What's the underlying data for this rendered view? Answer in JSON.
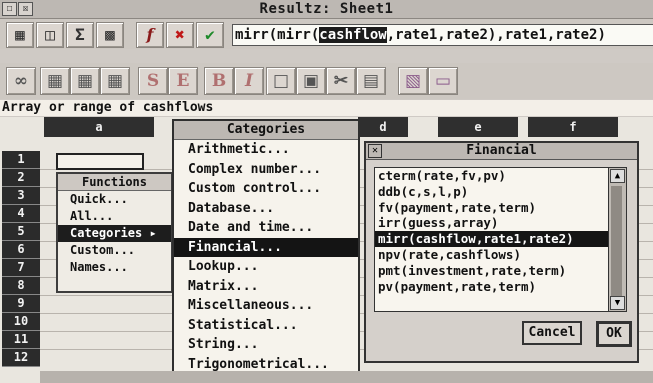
{
  "window": {
    "title": "Resultz: Sheet1",
    "close_glyph": "☒",
    "back_glyph": "☐"
  },
  "toolbar": {
    "sum_label": "Σ",
    "function_label": "f",
    "cancel_glyph": "✖",
    "accept_glyph": "✔",
    "formula_prefix": "mirr(mirr(",
    "formula_highlight": "cashflow",
    "formula_suffix": ",rate1,rate2),rate1,rate2)",
    "s_label": "S",
    "e_label": "E",
    "bold_label": "B",
    "italic_label": "I"
  },
  "status": {
    "text": "Array or range of cashflows"
  },
  "grid": {
    "col_headers": [
      "a",
      "d",
      "e",
      "f"
    ],
    "row_headers": [
      "1",
      "2",
      "3",
      "4",
      "5",
      "6",
      "7",
      "8",
      "9",
      "10",
      "11",
      "12"
    ]
  },
  "functions": {
    "title": "Functions",
    "items": [
      "Quick...",
      "All...",
      "Categories",
      "Custom...",
      "Names..."
    ],
    "selected_index": 2,
    "arrow_glyph": "▸"
  },
  "categories": {
    "title": "Categories",
    "items": [
      "Arithmetic...",
      "Complex number...",
      "Custom control...",
      "Database...",
      "Date and time...",
      "Financial...",
      "Lookup...",
      "Matrix...",
      "Miscellaneous...",
      "Statistical...",
      "String...",
      "Trigonometrical..."
    ],
    "selected_index": 5
  },
  "financial": {
    "title": "Financial",
    "items": [
      "cterm(rate,fv,pv)",
      "ddb(c,s,l,p)",
      "fv(payment,rate,term)",
      "irr(guess,array)",
      "mirr(cashflow,rate1,rate2)",
      "npv(rate,cashflows)",
      "pmt(investment,rate,term)",
      "pv(payment,rate,term)"
    ],
    "selected_index": 4,
    "close_glyph": "✕",
    "cancel_label": "Cancel",
    "ok_label": "OK"
  }
}
